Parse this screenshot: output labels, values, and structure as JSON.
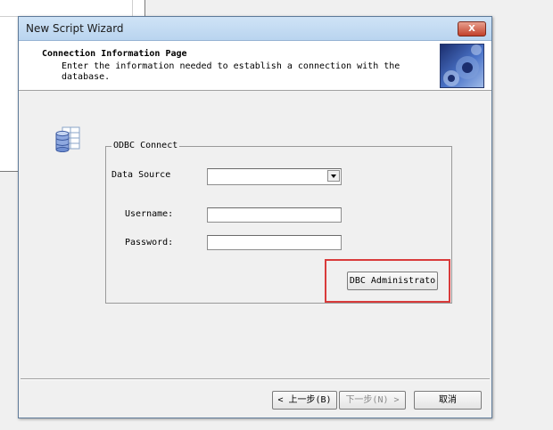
{
  "window": {
    "title": "New Script Wizard",
    "close_glyph": "X"
  },
  "header": {
    "title": "Connection Information Page",
    "description": "Enter the information needed to establish a connection with the database."
  },
  "odbc": {
    "group_label": "ODBC Connect",
    "data_source_label": "Data Source",
    "data_source_value": "",
    "username_label": "Username:",
    "username_value": "",
    "password_label": "Password:",
    "password_value": "",
    "admin_button_label": "DBC Administrato"
  },
  "footer": {
    "back_label": "< 上一步(B)",
    "next_label": "下一步(N) >",
    "cancel_label": "取消"
  },
  "colors": {
    "highlight": "#d93b3b",
    "titlebar": "#bcd6ef",
    "close": "#c2412b"
  },
  "icons": [
    "database-icon",
    "close-icon",
    "wizard-banner-graphic",
    "dropdown-arrow-icon"
  ]
}
